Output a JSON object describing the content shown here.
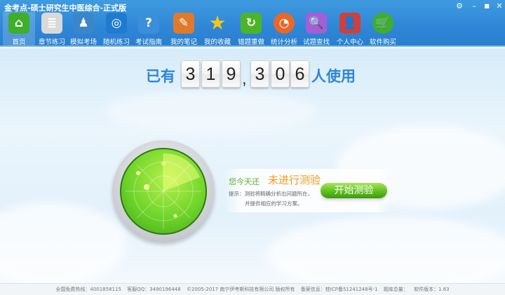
{
  "window": {
    "title": "金考点-硕士研究生中医综合-正式版",
    "settings": "⚙",
    "minimize": "–",
    "maximize": "■",
    "close": "✕"
  },
  "toolbar": [
    {
      "label": "首页",
      "icon": "home-icon",
      "glyph": "⌂",
      "color": "#3fae2a"
    },
    {
      "label": "章节练习",
      "icon": "document-person-icon",
      "glyph": "≣",
      "color": "#d9d9d9"
    },
    {
      "label": "模拟考场",
      "icon": "monitor-person-icon",
      "glyph": "♟",
      "color": "#3a86c8"
    },
    {
      "label": "随机练习",
      "icon": "random-circle-icon",
      "glyph": "◎",
      "color": "#1f7bd0"
    },
    {
      "label": "考试指南",
      "icon": "help-icon",
      "glyph": "?",
      "color": "#3b8fd9"
    },
    {
      "label": "我的笔记",
      "icon": "pencil-note-icon",
      "glyph": "✎",
      "color": "#e07a2a"
    },
    {
      "label": "我的收藏",
      "icon": "star-icon",
      "glyph": "★",
      "color": "#f5c518"
    },
    {
      "label": "错题重做",
      "icon": "redo-icon",
      "glyph": "↻",
      "color": "#4cb526"
    },
    {
      "label": "统计分析",
      "icon": "pie-chart-icon",
      "glyph": "◔",
      "color": "#e8682a"
    },
    {
      "label": "试题查找",
      "icon": "search-icon",
      "glyph": "🔍",
      "color": "#a35ed8"
    },
    {
      "label": "个人中心",
      "icon": "user-icon",
      "glyph": "👤",
      "color": "#d0403a"
    },
    {
      "label": "软件购买",
      "icon": "cart-icon",
      "glyph": "🛒",
      "color": "#3fae2a"
    }
  ],
  "counter": {
    "prefix": "已有",
    "digits": [
      "3",
      "1",
      "9",
      "3",
      "0",
      "6"
    ],
    "comma": ",",
    "suffix": "人使用"
  },
  "panel": {
    "status_prefix": "您今天还",
    "status": "未进行测验",
    "hint1": "提示：测验将精确分析出问题所在，",
    "hint2": "并提供相应的学习方案。",
    "start_button": "开始测验"
  },
  "footer": {
    "hotline": "全国免费热线：4001858115",
    "qq": "客服QQ：3490196448",
    "copyright": "©2005-2017  南宁伊考斯科技有限公司 版权所有",
    "icp": "备案信息：桂ICP备51241248号-1",
    "bank": "题库总量：",
    "version": "软件版本：1.63"
  }
}
